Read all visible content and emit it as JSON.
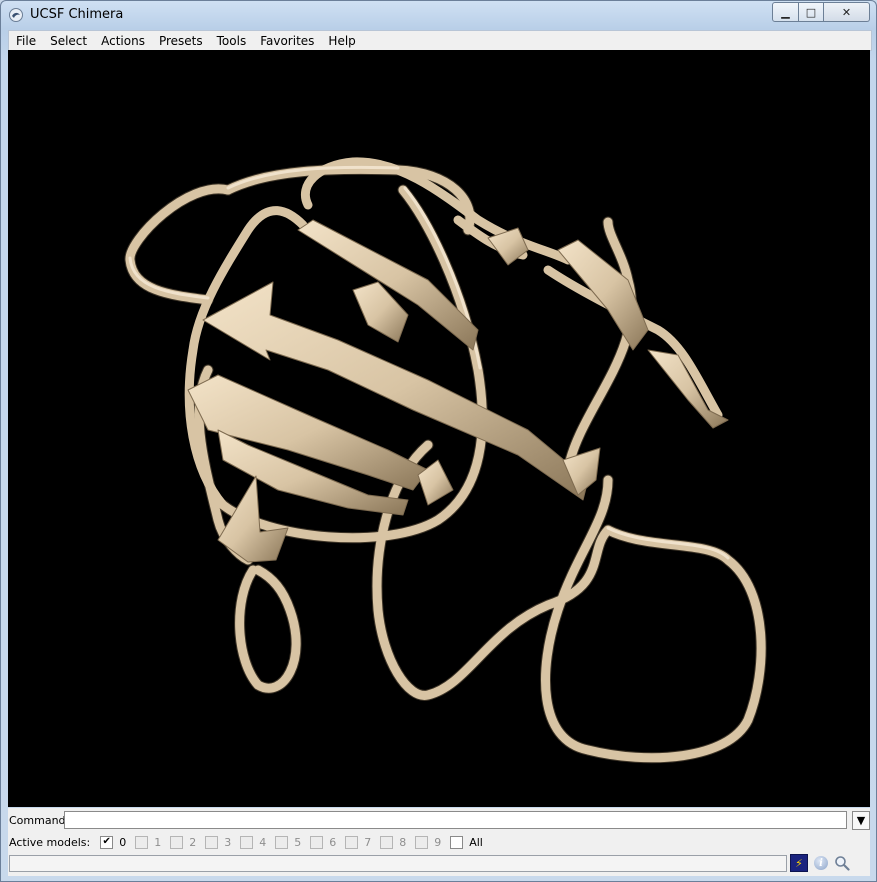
{
  "window": {
    "title": "UCSF Chimera"
  },
  "titlebar": {
    "minimize_glyph": "▁",
    "maximize_glyph": "□",
    "close_glyph": "✕"
  },
  "menubar": {
    "items": [
      "File",
      "Select",
      "Actions",
      "Presets",
      "Tools",
      "Favorites",
      "Help"
    ]
  },
  "viewport": {
    "background": "#000000",
    "ribbon_color": "#d8c4a4",
    "scene": "protein ribbon cartoon model"
  },
  "command": {
    "label": "Command:",
    "value": "",
    "dropdown_glyph": "▼"
  },
  "models": {
    "label": "Active models:",
    "items": [
      {
        "label": "0",
        "checked": true,
        "enabled": true
      },
      {
        "label": "1",
        "checked": false,
        "enabled": false
      },
      {
        "label": "2",
        "checked": false,
        "enabled": false
      },
      {
        "label": "3",
        "checked": false,
        "enabled": false
      },
      {
        "label": "4",
        "checked": false,
        "enabled": false
      },
      {
        "label": "5",
        "checked": false,
        "enabled": false
      },
      {
        "label": "6",
        "checked": false,
        "enabled": false
      },
      {
        "label": "7",
        "checked": false,
        "enabled": false
      },
      {
        "label": "8",
        "checked": false,
        "enabled": false
      },
      {
        "label": "9",
        "checked": false,
        "enabled": false
      },
      {
        "label": "All",
        "checked": false,
        "enabled": true
      }
    ]
  },
  "statusbar": {
    "text": "",
    "icons": [
      "lightning-bolt-icon",
      "info-icon",
      "magnifier-icon"
    ],
    "bolt_glyph": "⚡",
    "info_glyph": "i"
  },
  "colors": {
    "window_frame": "#c3d6ec",
    "panel": "#f0f0f0",
    "ribbon": "#d8c4a4",
    "bolt_bg": "#1a237e"
  }
}
